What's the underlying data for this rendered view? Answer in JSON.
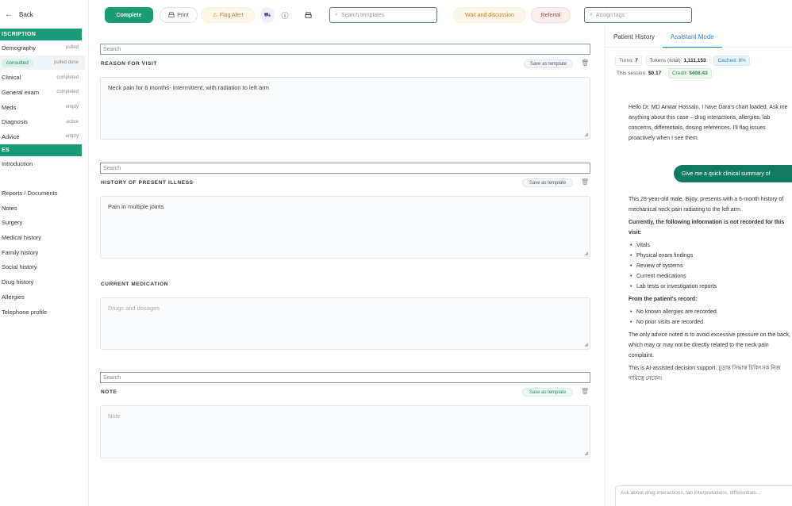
{
  "sidebar": {
    "back_label": "Back",
    "section1_title": "ISCRIPTION",
    "items": [
      {
        "label": "Demography",
        "status": "pulled",
        "active": false
      },
      {
        "label": "consulted",
        "status": "pulled done",
        "active": true
      },
      {
        "label": "Clinical",
        "status": "completed",
        "active": false
      },
      {
        "label": "General exam",
        "status": "completed",
        "active": false
      },
      {
        "label": "Meds",
        "status": "empty",
        "active": false
      },
      {
        "label": "Diagnosis",
        "status": "active",
        "active": false
      },
      {
        "label": "Advice",
        "status": "empty",
        "active": false
      }
    ],
    "section2_title": "ES",
    "items2": [
      {
        "label": "Introduction"
      },
      {
        "label": ""
      },
      {
        "label": "Reports / Documents"
      },
      {
        "label": "Notes"
      },
      {
        "label": "Surgery"
      },
      {
        "label": "Medical history"
      },
      {
        "label": "Family history"
      },
      {
        "label": "Social history"
      },
      {
        "label": "Drug history"
      },
      {
        "label": "Allergies"
      },
      {
        "label": "Telephone profile"
      }
    ]
  },
  "toolbar": {
    "primary_label": "Complete",
    "print_label": "Print",
    "flags_label": "Flag Alert",
    "search_placeholder": "Search templates",
    "request_label": "Wait and discussion",
    "referral_label": "Referral",
    "search2_placeholder": "Assign tags"
  },
  "form": {
    "search_placeholder": "Search",
    "sections": [
      {
        "label": "REASON FOR VISIT",
        "save_label": "Save as template",
        "value": "Neck pain for 6 months- Intermittent, with radiation to left arm",
        "placeholder": ""
      },
      {
        "label": "HISTORY OF PRESENT ILLNESS",
        "save_label": "Save as template",
        "value": "Pain in multiple joints",
        "placeholder": ""
      },
      {
        "label": "CURRENT MEDICATION",
        "save_label": "",
        "value": "",
        "placeholder": "Drugs and dosages"
      },
      {
        "label": "NOTE",
        "save_label": "Save as template",
        "value": "",
        "placeholder": "Note"
      }
    ]
  },
  "panel": {
    "tabs": [
      "Patient History",
      "Assistant Mode"
    ],
    "active_tab": 1,
    "stats": {
      "turns_label": "Turns:",
      "turns_value": "7",
      "tokens_label": "Tokens (total):",
      "tokens_value": "1,111,153",
      "cached_label": "Cached: 8%",
      "session_label": "This session:",
      "session_value": "$0.17",
      "credit_label": "Credit:",
      "credit_value": "$408.43"
    },
    "greeting": "Hello Dr. MD Anwar Hossain. I have Dara's chart loaded. Ask me anything about this case – drug interactions, allergies, lab concerns, differentials, dosing references. I'll flag issues proactively when I see them.",
    "user_message": "Give me a quick clinical summary of",
    "reply_intro": "This 28-year-old male, Bijoy, presents with a 6-month history of mechanical neck pain radiating to the left arm.",
    "missing_heading": "Currently, the following information is not recorded for this visit:",
    "missing_items": [
      "Vitals",
      "Physical exam findings",
      "Review of systems",
      "Current medications",
      "Lab tests or investigation reports"
    ],
    "record_heading": "From the patient's record:",
    "record_items": [
      "No known allergies are recorded.",
      "No prior visits are recorded."
    ],
    "advice_text": "The only advice noted is to avoid excessive pressure on the back, which may or may not be directly related to the neck pain complaint.",
    "disclaimer": "This is AI-assisted decision support. চূড়ান্ত সিদ্ধান্ত চিকিৎসক নিজ দায়িত্বে নেবেন।",
    "composer_placeholder": "Ask about drug interactions, lab interpretations, differentials..."
  }
}
